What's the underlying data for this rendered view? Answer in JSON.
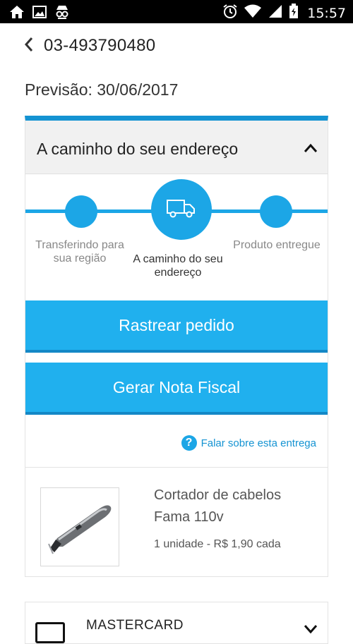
{
  "status_bar": {
    "time": "15:57"
  },
  "header": {
    "order_number": "03-493790480"
  },
  "forecast": "Previsão: 30/06/2017",
  "delivery_card": {
    "title": "A caminho do seu endereço",
    "steps": [
      {
        "label": "Transferindo para sua região"
      },
      {
        "label": "A caminho do seu endereço"
      },
      {
        "label": "Produto entregue"
      }
    ],
    "track_button": "Rastrear pedido",
    "invoice_button": "Gerar Nota Fiscal",
    "help_link": "Falar sobre esta entrega",
    "product": {
      "name": "Cortador de cabelos Fama 110v",
      "quantity_price": "1 unidade - R$ 1,90 cada"
    }
  },
  "payment_card": {
    "label": "MASTERCARD"
  },
  "colors": {
    "accent": "#1ca6e6",
    "button": "#20b0ee",
    "topbar": "#1493d2"
  }
}
